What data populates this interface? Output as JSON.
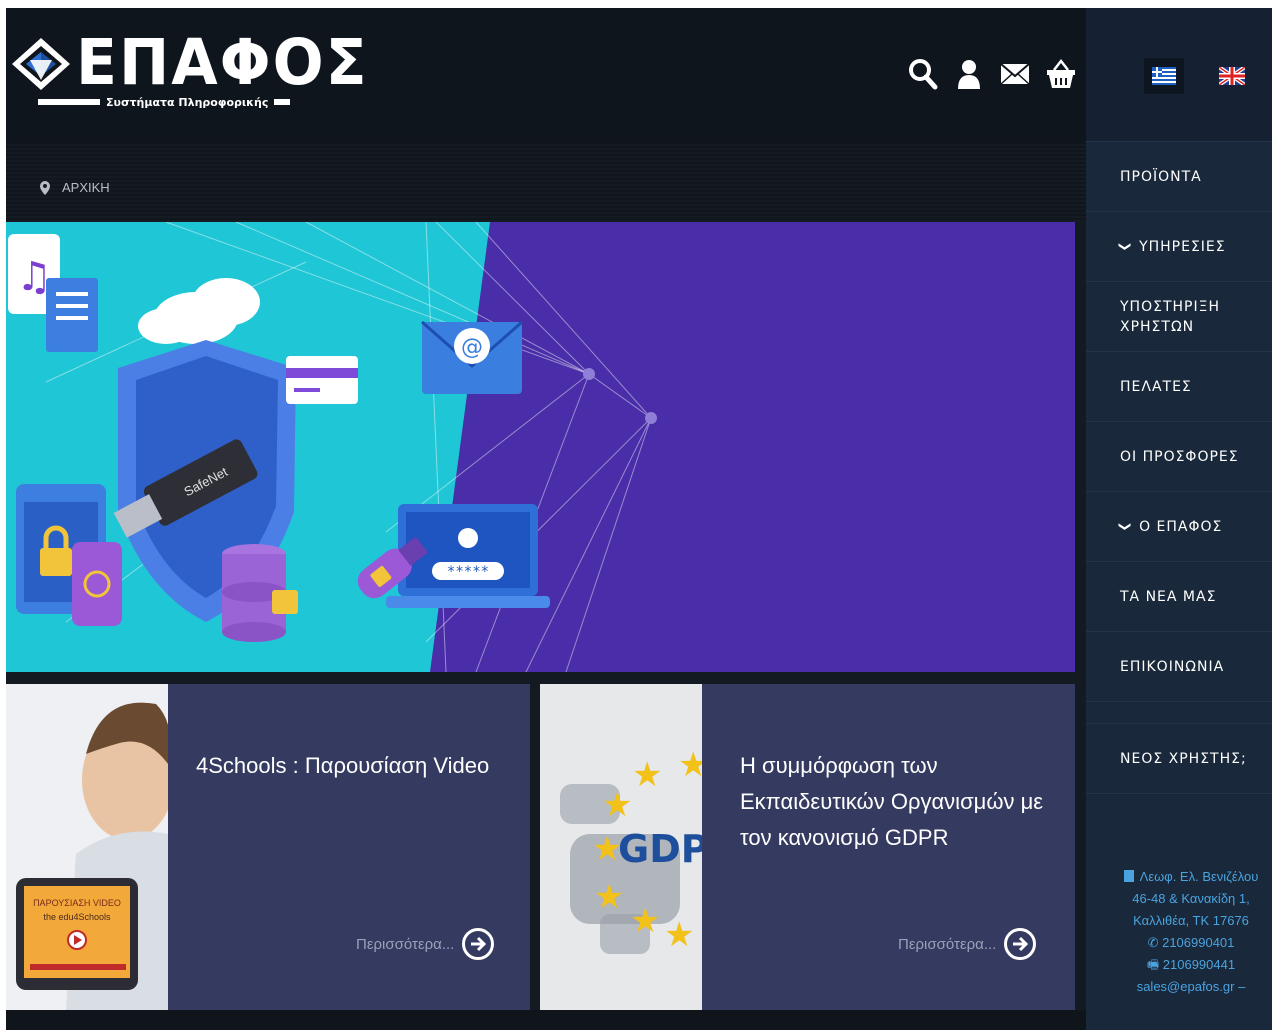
{
  "header": {
    "logo_text": "ΕΠΑΦΟΣ",
    "logo_subtitle": "Συστήματα Πληροφορικής",
    "icons": [
      "search-icon",
      "user-icon",
      "mail-icon",
      "basket-icon"
    ]
  },
  "languages": [
    "greek-flag",
    "uk-flag"
  ],
  "breadcrumb": {
    "home": "ΑΡΧΙΚΗ"
  },
  "nav": {
    "items": [
      {
        "label": "ΠΡΟΪΟΝΤΑ",
        "chevron": false
      },
      {
        "label": "ΥΠΗΡΕΣΙΕΣ",
        "chevron": true
      },
      {
        "label": "ΥΠΟΣΤΗΡΙΞΗ ΧΡΗΣΤΩΝ",
        "chevron": false
      },
      {
        "label": "ΠΕΛΑΤΕΣ",
        "chevron": false
      },
      {
        "label": "ΟΙ ΠΡΟΣΦΟΡΕΣ",
        "chevron": false
      },
      {
        "label": "Ο ΕΠΑΦΟΣ",
        "chevron": true
      },
      {
        "label": "ΤΑ ΝΕΑ ΜΑΣ",
        "chevron": false
      },
      {
        "label": "ΕΠΙΚΟΙΝΩΝΙΑ",
        "chevron": false
      }
    ],
    "new_user": "ΝΕΟΣ ΧΡΗΣΤΗΣ;"
  },
  "contact": {
    "address_line1": "Λεωφ. Ελ. Βενιζέλου",
    "address_line2": "46-48 & Κανακίδη 1,",
    "address_line3": "Καλλιθέα, ΤΚ 17676",
    "phone": "2106990401",
    "fax": "2106990441",
    "email": "sales@epafos.gr –"
  },
  "hero": {
    "usb_label": "SafeNet",
    "password_mask": "*****"
  },
  "cards": [
    {
      "title": "4Schools : Παρουσίαση Video",
      "more": "Περισσότερα...",
      "thumb_caption_1": "ΠΑΡΟΥΣΙΑΣΗ VIDEO",
      "thumb_caption_2": "the edu4Schools"
    },
    {
      "title": "Η συμμόρφωση των Εκπαιδευτικών Οργανισμών με τον κανονισμό GDPR",
      "more": "Περισσότερα...",
      "thumb_caption_1": "GDPR"
    }
  ],
  "colors": {
    "accent_blue": "#4aa3df",
    "card_bg": "#343a60",
    "hero_purple": "#4a2da8",
    "hero_cyan": "#1fc6d6"
  }
}
